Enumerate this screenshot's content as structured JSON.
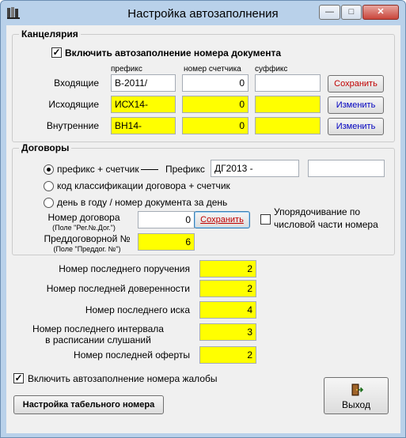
{
  "window": {
    "title": "Настройка автозаполнения"
  },
  "kanc": {
    "title": "Канцелярия",
    "enable_label": "Включить автозаполнение номера документа",
    "enable_checked": true,
    "col_prefix": "префикс",
    "col_counter": "номер счетчика",
    "col_suffix": "суффикс",
    "rows": [
      {
        "label": "Входящие",
        "prefix": "B-2011/",
        "counter": "0",
        "suffix": "",
        "button": "Сохранить"
      },
      {
        "label": "Исходящие",
        "prefix": "ИСХ14-",
        "counter": "0",
        "suffix": "",
        "button": "Изменить"
      },
      {
        "label": "Внутренние",
        "prefix": "ВН14-",
        "counter": "0",
        "suffix": "",
        "button": "Изменить"
      }
    ]
  },
  "dog": {
    "title": "Договоры",
    "radio1": "префикс + счетчик",
    "prefix_label": "Префикс",
    "prefix_value": "ДГ2013 -",
    "extra_value": "",
    "radio2": "код классификации  договора + счетчик",
    "radio3": "день в году / номер документа за день",
    "selected_radio": 1,
    "number_label": "Номер договора",
    "number_hint": "(Поле \"Рег.№.Дог.\")",
    "number_value": "0",
    "save_label": "Сохранить",
    "sort_label_1": "Упорядочивание по",
    "sort_label_2": "числовой части номера",
    "sort_checked": false,
    "pre_label": "Преддоговорной №",
    "pre_hint": "(Поле \"Преддог. №\")",
    "pre_value": "6"
  },
  "last": [
    {
      "label": "Номер последнего поручения",
      "value": "2"
    },
    {
      "label": "Номер последней доверенности",
      "value": "2"
    },
    {
      "label": "Номер последнего иска",
      "value": "4"
    },
    {
      "label_1": "Номер последнего интервала",
      "label_2": "в расписании слушаний",
      "value": "3"
    },
    {
      "label": "Номер последней оферты",
      "value": "2"
    }
  ],
  "complaint": {
    "label": "Включить автозаполнение номера жалобы",
    "checked": true
  },
  "buttons": {
    "tabel": "Настройка табельного номера",
    "exit": "Выход"
  },
  "colors": {
    "highlight": "#ffff00",
    "window_frame": "#b9d1ea",
    "client_bg": "#f0f0f0",
    "save_text": "#c00000",
    "edit_text": "#0000c0"
  }
}
